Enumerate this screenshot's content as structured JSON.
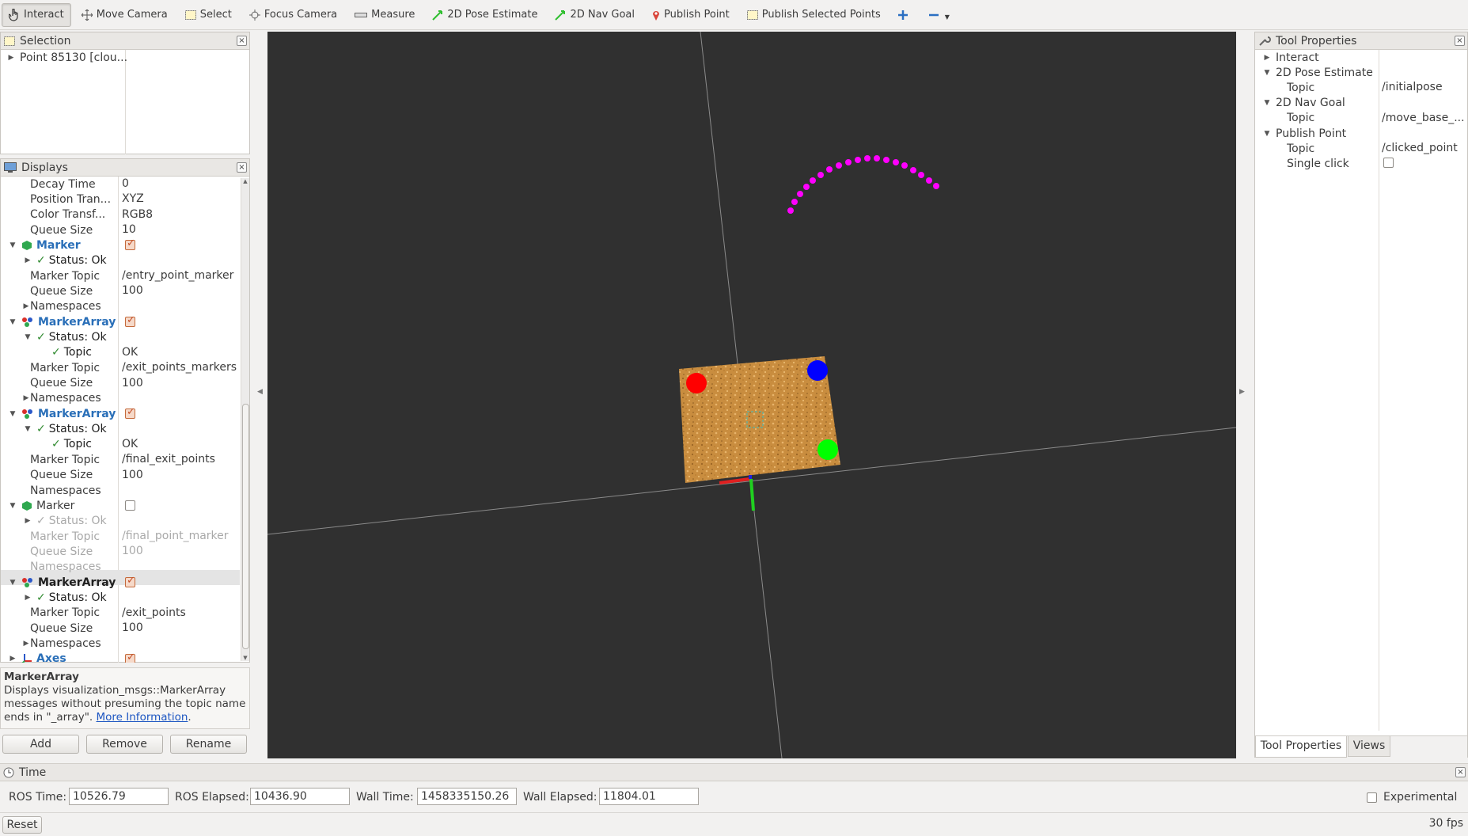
{
  "toolbar": {
    "interact": "Interact",
    "move_camera": "Move Camera",
    "select": "Select",
    "focus_camera": "Focus Camera",
    "measure": "Measure",
    "pose_estimate": "2D Pose Estimate",
    "nav_goal": "2D Nav Goal",
    "publish_point": "Publish Point",
    "publish_selected": "Publish Selected Points"
  },
  "selection": {
    "title": "Selection",
    "item": "Point 85130 [clou..."
  },
  "displays": {
    "title": "Displays",
    "rows": [
      {
        "name": "Decay Time",
        "value": "0"
      },
      {
        "name": "Position Tran...",
        "value": "XYZ"
      },
      {
        "name": "Color Transf...",
        "value": "RGB8"
      },
      {
        "name": "Queue Size",
        "value": "10"
      },
      {
        "name": "Marker",
        "value": ""
      },
      {
        "name": "Status: Ok",
        "value": ""
      },
      {
        "name": "Marker Topic",
        "value": "/entry_point_marker"
      },
      {
        "name": "Queue Size",
        "value": "100"
      },
      {
        "name": "Namespaces",
        "value": ""
      },
      {
        "name": "MarkerArray",
        "value": ""
      },
      {
        "name": "Status: Ok",
        "value": ""
      },
      {
        "name": "Topic",
        "value": "OK"
      },
      {
        "name": "Marker Topic",
        "value": "/exit_points_markers"
      },
      {
        "name": "Queue Size",
        "value": "100"
      },
      {
        "name": "Namespaces",
        "value": ""
      },
      {
        "name": "MarkerArray",
        "value": ""
      },
      {
        "name": "Status: Ok",
        "value": ""
      },
      {
        "name": "Topic",
        "value": "OK"
      },
      {
        "name": "Marker Topic",
        "value": "/final_exit_points"
      },
      {
        "name": "Queue Size",
        "value": "100"
      },
      {
        "name": "Namespaces",
        "value": ""
      },
      {
        "name": "Marker",
        "value": ""
      },
      {
        "name": "Status: Ok",
        "value": ""
      },
      {
        "name": "Marker Topic",
        "value": "/final_point_marker"
      },
      {
        "name": "Queue Size",
        "value": "100"
      },
      {
        "name": "Namespaces",
        "value": ""
      },
      {
        "name": "MarkerArray",
        "value": ""
      },
      {
        "name": "Status: Ok",
        "value": ""
      },
      {
        "name": "Marker Topic",
        "value": "/exit_points"
      },
      {
        "name": "Queue Size",
        "value": "100"
      },
      {
        "name": "Namespaces",
        "value": ""
      },
      {
        "name": "Axes",
        "value": ""
      }
    ]
  },
  "description": {
    "title": "MarkerArray",
    "text": "Displays visualization_msgs::MarkerArray messages without presuming the topic name ends in \"_array\".",
    "link": "More Information",
    "end": "."
  },
  "buttons": {
    "add": "Add",
    "remove": "Remove",
    "rename": "Rename"
  },
  "tool_properties": {
    "title": "Tool Properties",
    "rows": [
      {
        "name": "Interact",
        "value": ""
      },
      {
        "name": "2D Pose Estimate",
        "value": ""
      },
      {
        "name": "Topic",
        "value": "/initialpose"
      },
      {
        "name": "2D Nav Goal",
        "value": ""
      },
      {
        "name": "Topic",
        "value": "/move_base_..."
      },
      {
        "name": "Publish Point",
        "value": ""
      },
      {
        "name": "Topic",
        "value": "/clicked_point"
      },
      {
        "name": "Single click",
        "value": ""
      }
    ],
    "tab_tool": "Tool Properties",
    "tab_views": "Views"
  },
  "time": {
    "title": "Time",
    "ros_time_label": "ROS Time:",
    "ros_time": "10526.79",
    "ros_elapsed_label": "ROS Elapsed:",
    "ros_elapsed": "10436.90",
    "wall_time_label": "Wall Time:",
    "wall_time": "1458335150.26",
    "wall_elapsed_label": "Wall Elapsed:",
    "wall_elapsed": "11804.01",
    "experimental": "Experimental"
  },
  "status": {
    "reset": "Reset",
    "fps": "30 fps"
  },
  "colors": {
    "viewport_bg": "#303030",
    "magenta": "#ff00ff",
    "red": "#ff0000",
    "blue": "#0000ff",
    "green": "#00ff00"
  }
}
